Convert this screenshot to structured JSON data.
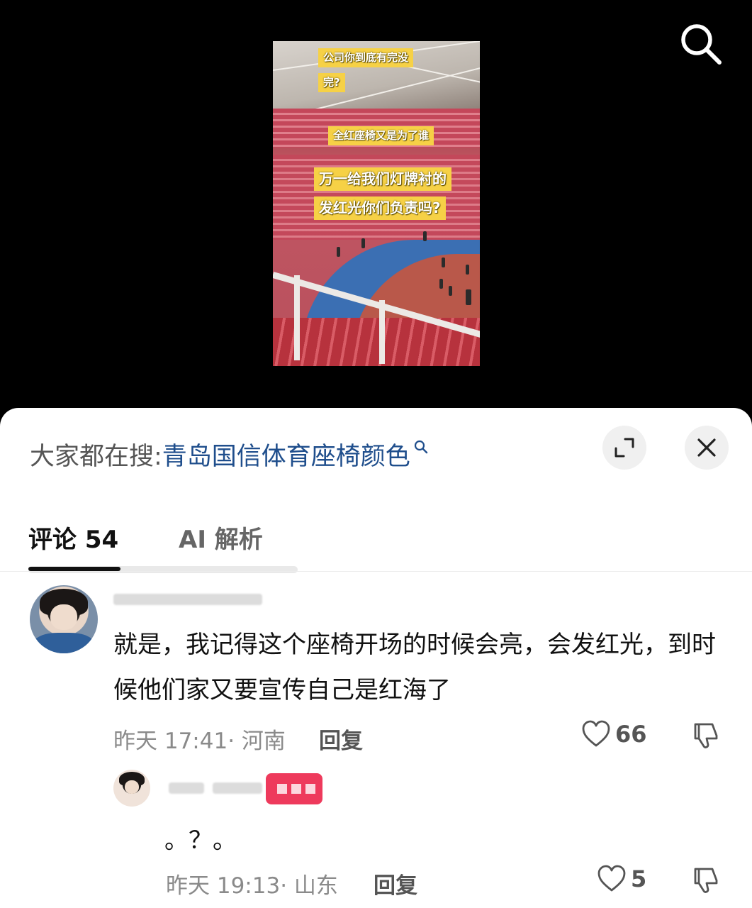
{
  "video": {
    "captions": [
      "公司你到底有完没",
      "完?",
      "全红座椅又是为了谁",
      "万一给我们灯牌衬的",
      "发红光你们负责吗?"
    ]
  },
  "sheet": {
    "trending_label": "大家都在搜:",
    "trending_term": "青岛国信体育座椅颜色",
    "tabs": [
      {
        "label": "评论 54",
        "active": true
      },
      {
        "label": "AI 解析",
        "active": false
      }
    ]
  },
  "comments": [
    {
      "text": "就是，我记得这个座椅开场的时候会亮，会发红光，到时候他们家又要宣传自己是红海了",
      "meta": "昨天 17:41· 河南",
      "reply_label": "回复",
      "likes": "66"
    },
    {
      "text": "。？。",
      "meta": "昨天 19:13· 山东",
      "reply_label": "回复",
      "likes": "5"
    }
  ],
  "colors": {
    "trending_term": "#1f4e8c",
    "caption_bg": "#f6d146",
    "badge": "#ee3a5c"
  },
  "icons": [
    "search-icon",
    "expand-icon",
    "close-icon",
    "heart-icon",
    "thumbs-down-icon"
  ]
}
